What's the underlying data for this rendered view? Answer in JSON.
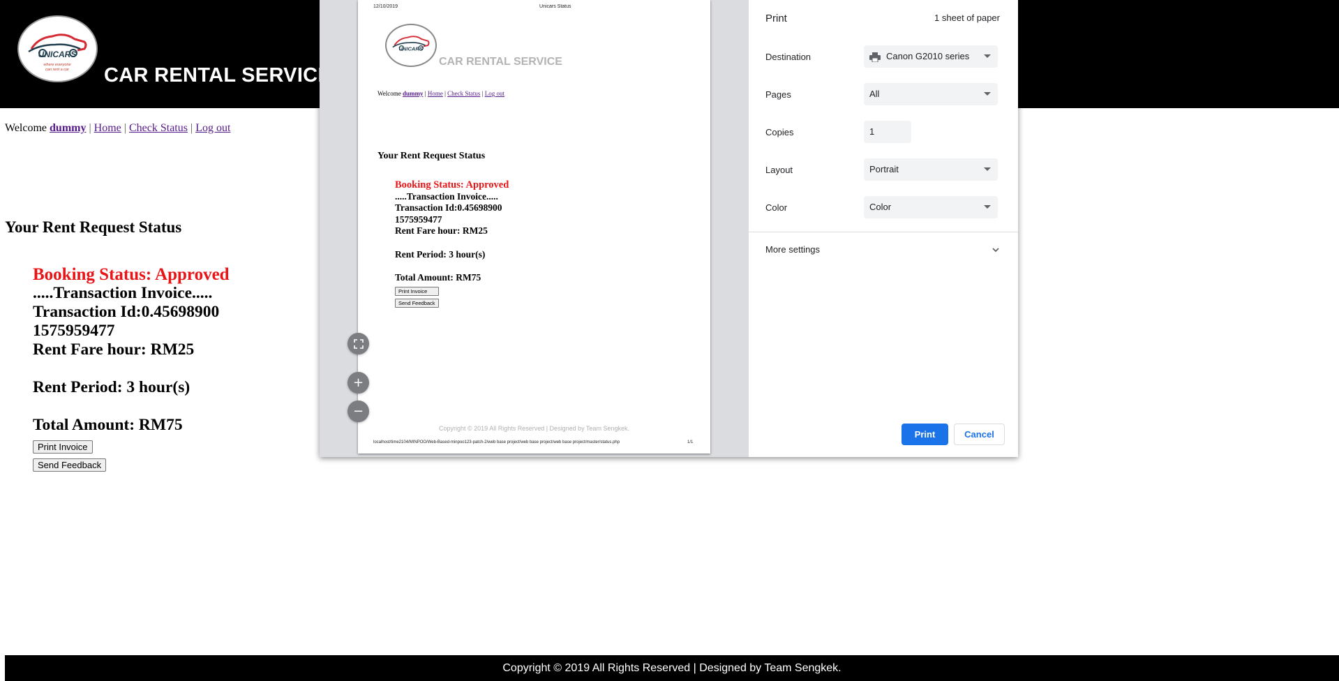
{
  "site": {
    "logo_text": "UNICARS",
    "logo_tagline": "where everyone can rent a car",
    "title": "CAR RENTAL SERVICE",
    "footer": "Copyright © 2019 All Rights Reserved | Designed by Team Sengkek."
  },
  "nav": {
    "welcome": "Welcome",
    "user": "dummy",
    "sep": "|",
    "home": "Home",
    "check_status": "Check Status",
    "logout": "Log out"
  },
  "status": {
    "heading": "Your Rent Request Status",
    "booking_status": "Booking Status: Approved",
    "invoice_title": ".....Transaction Invoice.....",
    "transaction_id": "Transaction Id:0.45698900",
    "transaction_id_cont": "1575959477",
    "rent_fare": "Rent Fare hour: RM25",
    "rent_period": "Rent Period: 3 hour(s)",
    "total_amount": "Total Amount: RM75",
    "print_invoice": "Print Invoice",
    "send_feedback": "Send Feedback"
  },
  "preview": {
    "date": "12/10/2019",
    "page_title": "Unicars Status",
    "url": "localhost/time2104/MINPOO/Web-Based-minpoo123-patch-2/web base project/web base project/web base project/master/status.php",
    "page_number": "1/1"
  },
  "print_dialog": {
    "title": "Print",
    "sheets": "1 sheet of paper",
    "destination_label": "Destination",
    "destination_value": "Canon G2010 series",
    "pages_label": "Pages",
    "pages_value": "All",
    "copies_label": "Copies",
    "copies_value": "1",
    "layout_label": "Layout",
    "layout_value": "Portrait",
    "color_label": "Color",
    "color_value": "Color",
    "more_settings": "More settings",
    "print_button": "Print",
    "cancel_button": "Cancel"
  },
  "colors": {
    "approved": "#e81416",
    "print_blue": "#1a73e8",
    "header_bg": "#000000"
  }
}
